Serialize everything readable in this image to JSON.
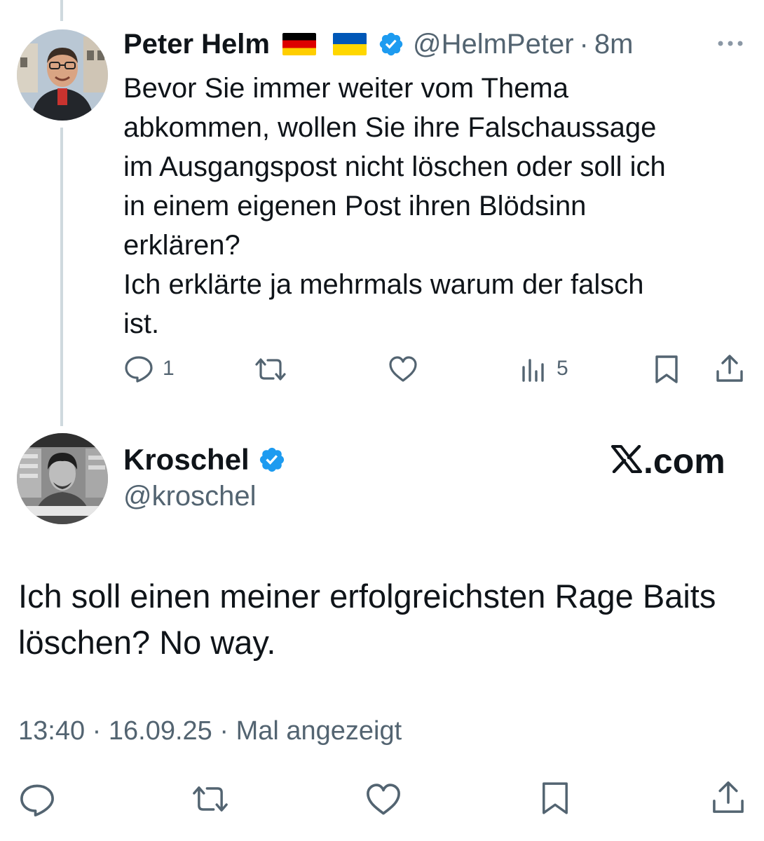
{
  "reply": {
    "author_name": "Peter Helm",
    "flags": [
      "german-flag",
      "ukrainian-flag"
    ],
    "handle": "@HelmPeter",
    "separator": "·",
    "time": "8m",
    "text_lines": [
      "Bevor Sie immer weiter vom Thema",
      "abkommen, wollen Sie ihre Falschaussage",
      "im Ausgangspost nicht löschen oder soll ich",
      "in einem eigenen Post ihren Blödsinn",
      "erklären?",
      "Ich erklärte ja mehrmals warum der falsch",
      "ist."
    ],
    "actions": {
      "reply_count": "1",
      "retweet_count": "",
      "like_count": "",
      "views_count": "5"
    }
  },
  "main": {
    "author_name": "Kroschel",
    "handle": "@kroschel",
    "brand": ".com",
    "text_lines": [
      "Ich soll einen meiner erfolgreichsten Rage Baits",
      "löschen? No way."
    ],
    "time": "13:40",
    "date": "16.09.25",
    "views_label": "Mal angezeigt",
    "separator": "·"
  },
  "icons": {
    "more": "more-icon",
    "verified": "verified-badge-icon",
    "reply": "reply-icon",
    "retweet": "retweet-icon",
    "like": "like-icon",
    "views": "views-icon",
    "bookmark": "bookmark-icon",
    "share": "share-icon"
  },
  "colors": {
    "verified_blue": "#1d9bf0",
    "secondary_text": "#536471",
    "primary_text": "#0f1419",
    "thread_line": "#cfd9de"
  }
}
